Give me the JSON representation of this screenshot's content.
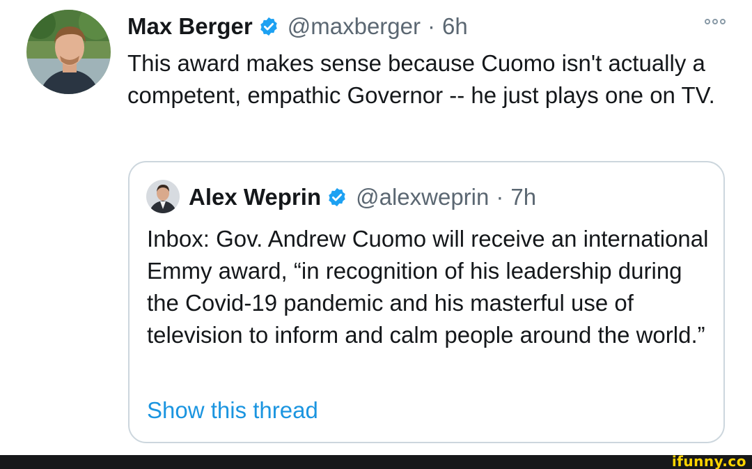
{
  "tweet": {
    "author_name": "Max Berger",
    "handle": "@maxberger",
    "separator": "·",
    "time": "6h",
    "text": "This award makes sense because Cuomo isn't actually a competent, empathic Governor -- he just plays one on TV.",
    "more_icon": "ellipsis-icon"
  },
  "quoted_tweet": {
    "author_name": "Alex Weprin",
    "handle": "@alexweprin",
    "separator": "·",
    "time": "7h",
    "text": "Inbox: Gov. Andrew Cuomo will receive an international Emmy award, “in recognition of his leadership during the Covid-19 pandemic and his masterful use of television to inform and calm people around the world.”",
    "show_thread_label": "Show this thread"
  },
  "watermark": {
    "text": "ifunny.co"
  },
  "colors": {
    "verified": "#1da1f2",
    "link": "#1b95e0",
    "secondary_text": "#5b6772",
    "border": "#ccd6dd"
  }
}
